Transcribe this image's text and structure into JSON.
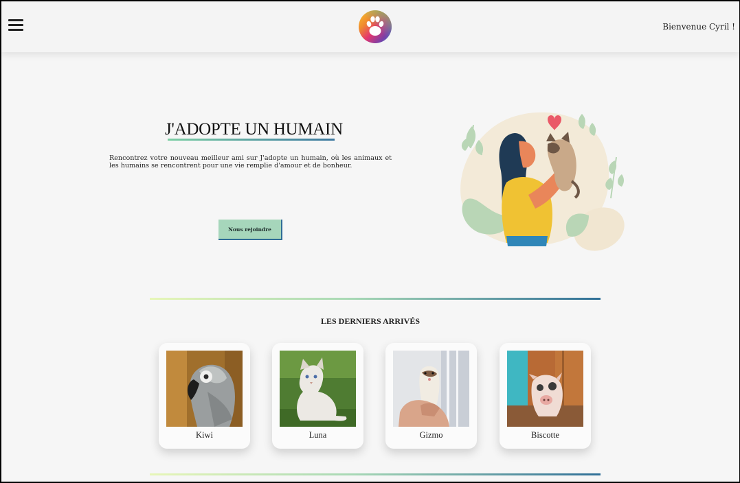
{
  "header": {
    "welcome": "Bienvenue Cyril !",
    "menu_icon": "hamburger-menu-icon",
    "logo_icon": "paw-logo-icon"
  },
  "hero": {
    "title": "J'ADOPTE UN HUMAIN",
    "text": "Rencontrez votre nouveau meilleur ami sur J'adopte un humain, où les animaux et les humains se rencontrent pour une vie remplie d'amour et de bonheur.",
    "cta_label": "Nous rejoindre",
    "illustration": "woman-hugging-cat-illustration"
  },
  "latest": {
    "title": "LES DERNIERS ARRIVÉS",
    "pets": [
      {
        "name": "Kiwi",
        "photo": "grey-parrot-photo"
      },
      {
        "name": "Luna",
        "photo": "white-cat-photo"
      },
      {
        "name": "Gizmo",
        "photo": "ferret-photo"
      },
      {
        "name": "Biscotte",
        "photo": "pig-photo"
      }
    ]
  },
  "colors": {
    "accent_green": "#a6d6bb",
    "accent_blue": "#2f6d96",
    "background": "#f6f6f6"
  }
}
